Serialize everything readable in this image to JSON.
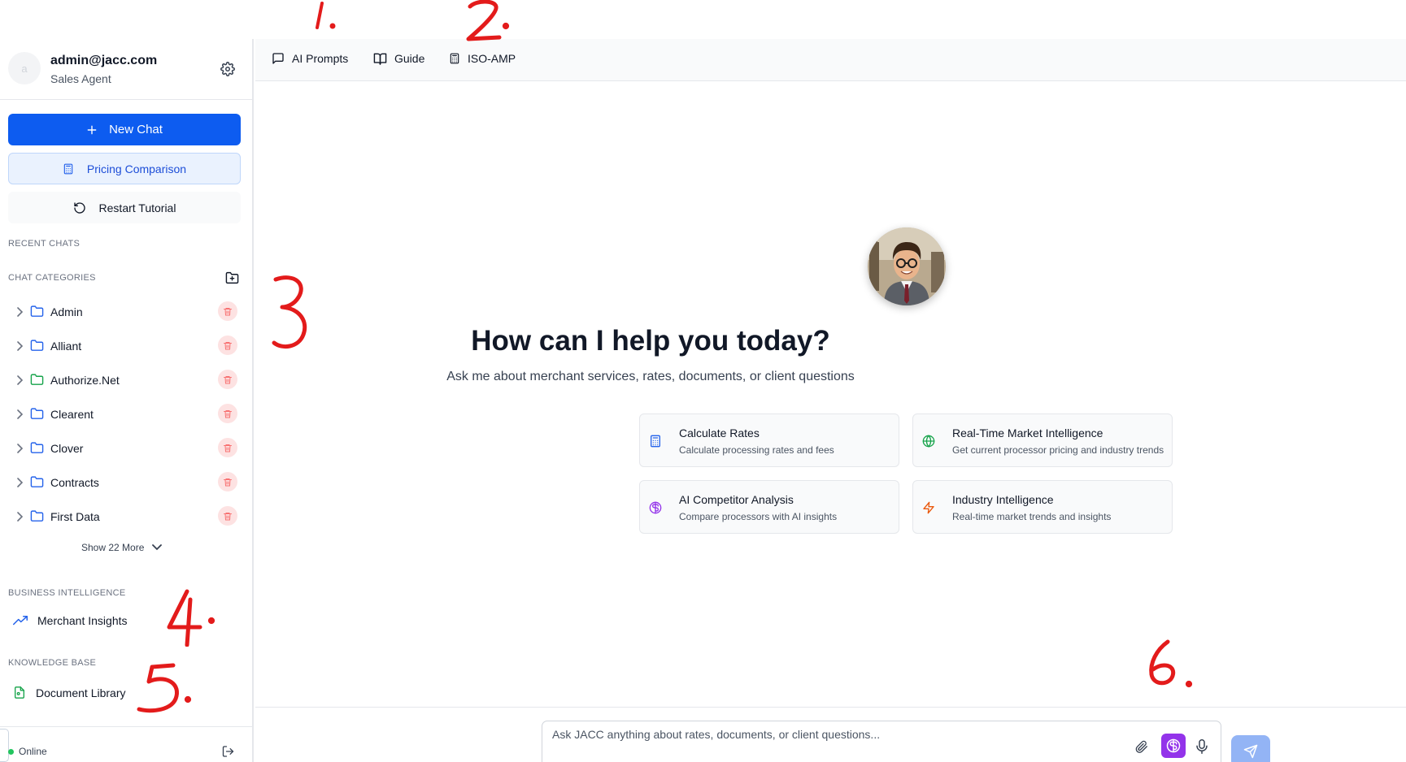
{
  "profile": {
    "avatar_letter": "a",
    "email": "admin@jacc.com",
    "role": "Sales Agent"
  },
  "sidebar": {
    "new_chat_label": "New Chat",
    "pricing_label": "Pricing Comparison",
    "restart_label": "Restart Tutorial",
    "recent_chats_heading": "RECENT CHATS",
    "categories_heading": "CHAT CATEGORIES",
    "categories": [
      {
        "label": "Admin",
        "folder_color": "#2563eb"
      },
      {
        "label": "Alliant",
        "folder_color": "#2563eb"
      },
      {
        "label": "Authorize.Net",
        "folder_color": "#16a34a"
      },
      {
        "label": "Clearent",
        "folder_color": "#2563eb"
      },
      {
        "label": "Clover",
        "folder_color": "#2563eb"
      },
      {
        "label": "Contracts",
        "folder_color": "#2563eb"
      },
      {
        "label": "First Data",
        "folder_color": "#2563eb"
      }
    ],
    "show_more_label": "Show 22 More",
    "business_intelligence_heading": "BUSINESS INTELLIGENCE",
    "merchant_insights_label": "Merchant Insights",
    "knowledge_base_heading": "KNOWLEDGE BASE",
    "document_library_label": "Document Library",
    "status_label": "Online"
  },
  "topbar": {
    "tabs": [
      {
        "label": "AI Prompts",
        "icon": "message-square-icon"
      },
      {
        "label": "Guide",
        "icon": "book-open-icon"
      },
      {
        "label": "ISO-AMP",
        "icon": "calculator-icon"
      }
    ]
  },
  "main": {
    "title": "How can I help you today?",
    "subtitle": "Ask me about merchant services, rates, documents, or client questions",
    "cards": [
      {
        "title": "Calculate Rates",
        "desc": "Calculate processing rates and fees",
        "icon": "calculator-icon",
        "color": "#2563eb"
      },
      {
        "title": "Real-Time Market Intelligence",
        "desc": "Get current processor pricing and industry trends",
        "icon": "globe-icon",
        "color": "#16a34a"
      },
      {
        "title": "AI Competitor Analysis",
        "desc": "Compare processors with AI insights",
        "icon": "brain-icon",
        "color": "#9333ea"
      },
      {
        "title": "Industry Intelligence",
        "desc": "Real-time market trends and insights",
        "icon": "zap-icon",
        "color": "#ea580c"
      }
    ]
  },
  "input": {
    "placeholder": "Ask JACC anything about rates, documents, or client questions..."
  },
  "annotations": [
    "1.",
    "2.",
    "3",
    "4.",
    "5.",
    "6."
  ],
  "colors": {
    "primary": "#0d5cf0",
    "annotation_red": "#e31b1b",
    "delete_bg": "#fde2e2"
  }
}
